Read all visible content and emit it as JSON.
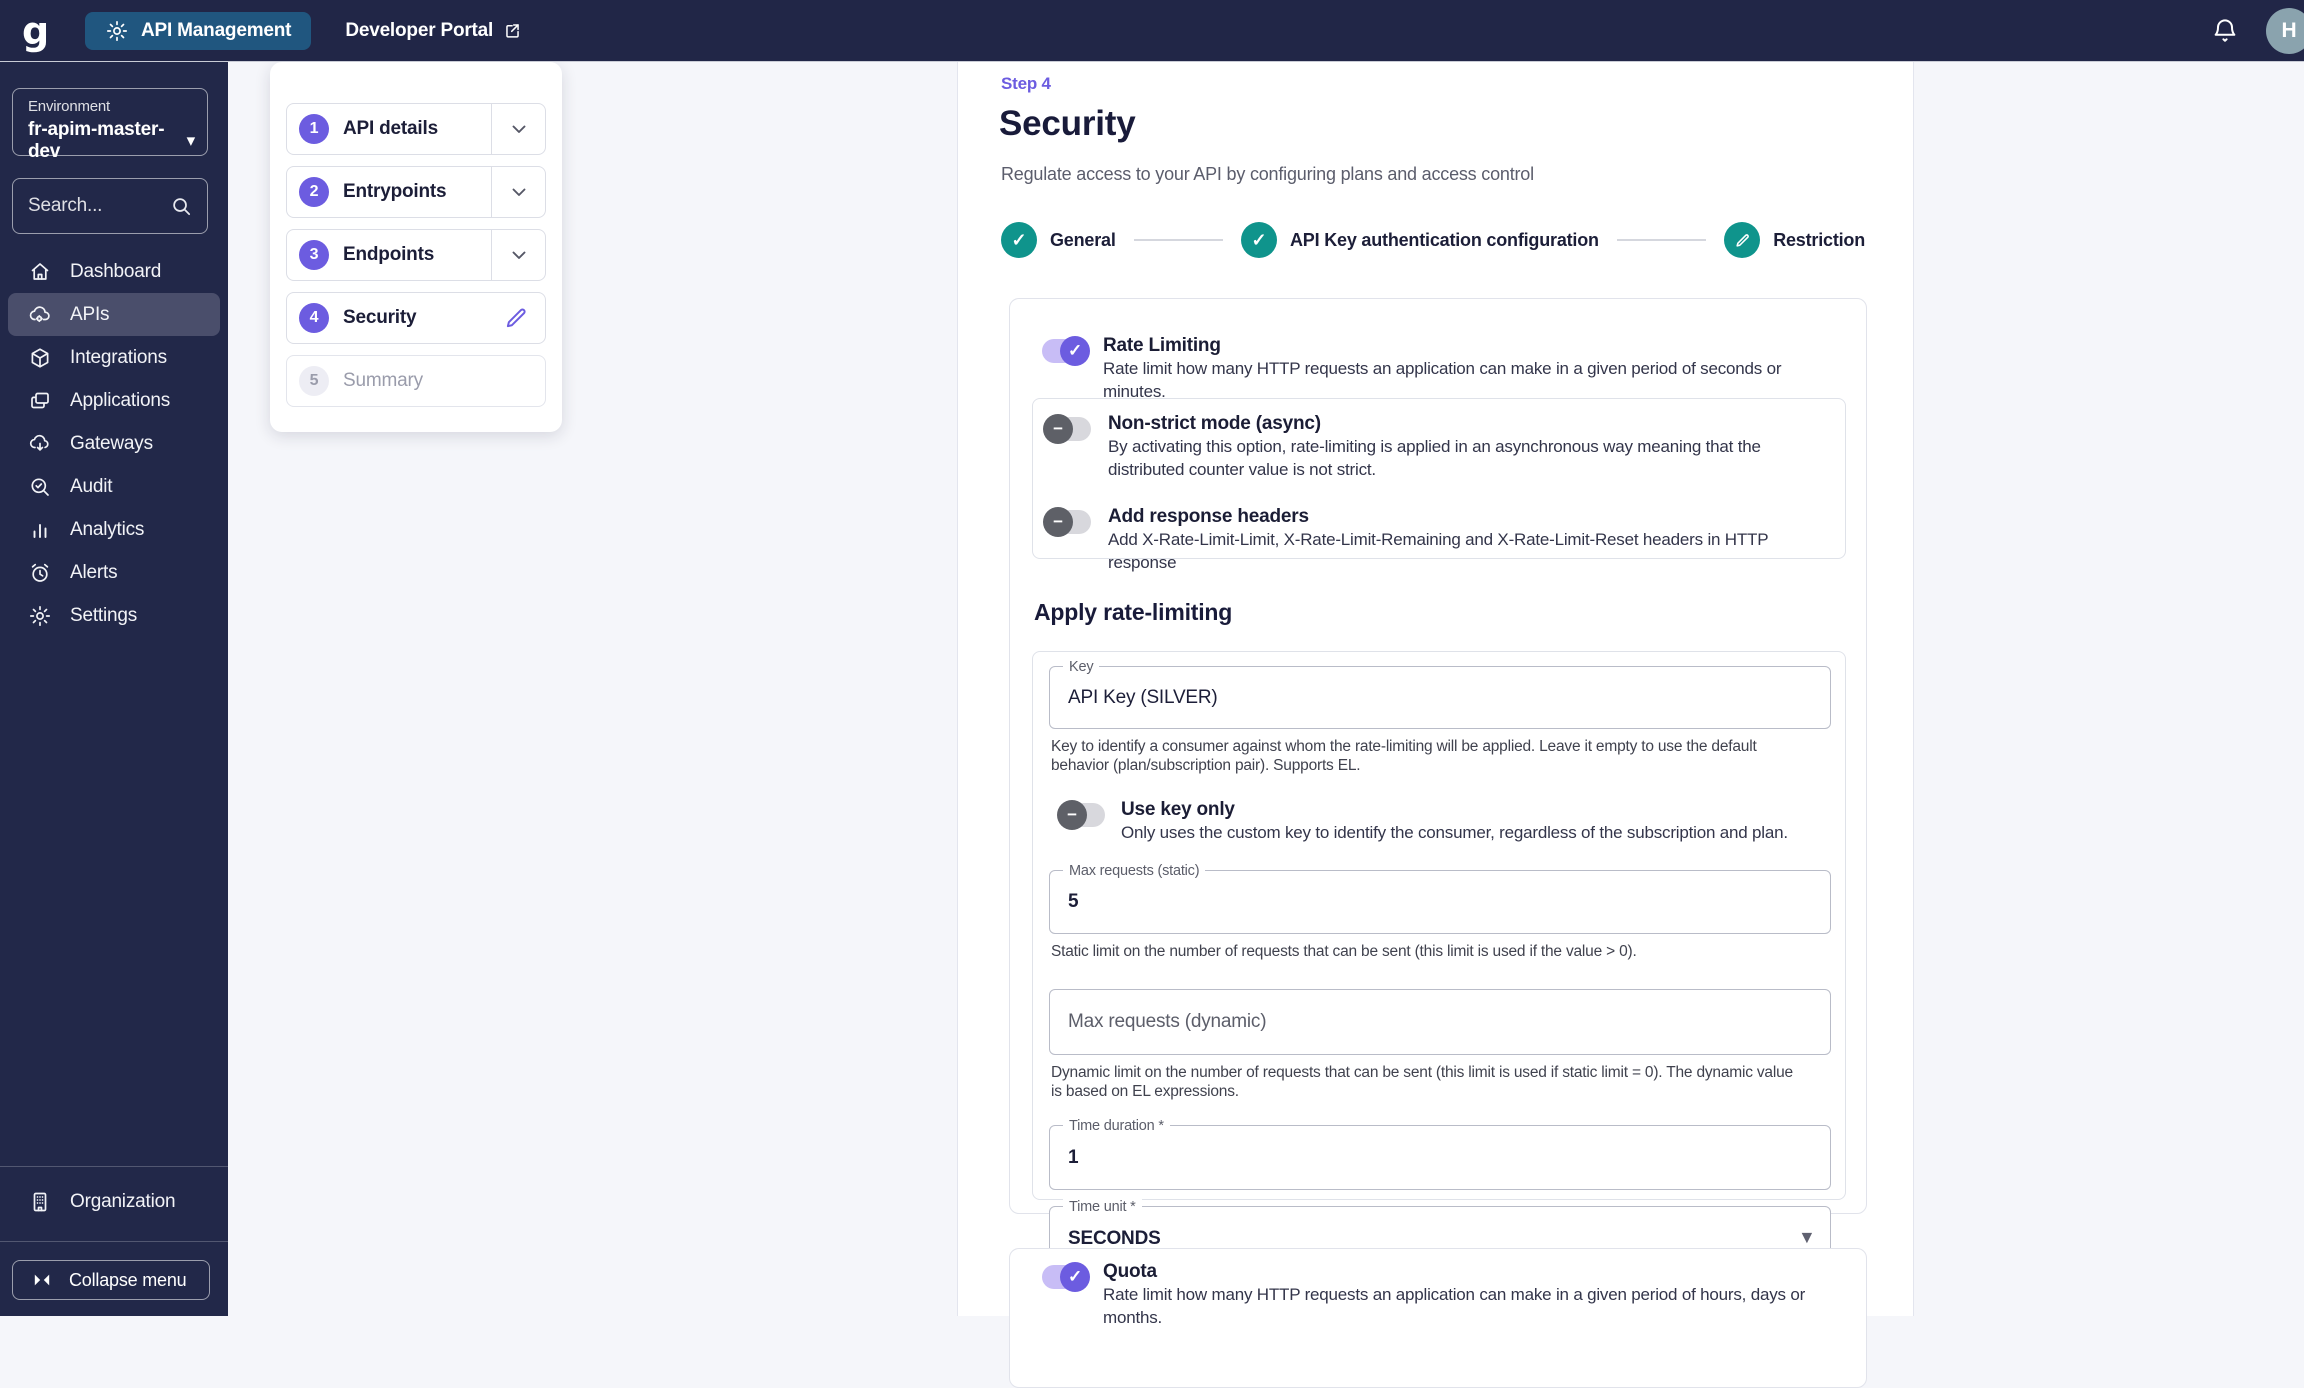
{
  "topbar": {
    "logo": "g",
    "apim_label": "API Management",
    "portal_label": "Developer Portal",
    "avatar_initial": "H"
  },
  "sidebar": {
    "environment_label": "Environment",
    "environment_value": "fr-apim-master-dev",
    "search_placeholder": "Search...",
    "items": [
      {
        "label": "Dashboard",
        "icon": "home-icon",
        "selected": false
      },
      {
        "label": "APIs",
        "icon": "cloud-gear-icon",
        "selected": true
      },
      {
        "label": "Integrations",
        "icon": "cube-icon",
        "selected": false
      },
      {
        "label": "Applications",
        "icon": "copies-icon",
        "selected": false
      },
      {
        "label": "Gateways",
        "icon": "cloud-down-icon",
        "selected": false
      },
      {
        "label": "Audit",
        "icon": "search-check-icon",
        "selected": false
      },
      {
        "label": "Analytics",
        "icon": "bar-chart-icon",
        "selected": false
      },
      {
        "label": "Alerts",
        "icon": "alarm-icon",
        "selected": false
      },
      {
        "label": "Settings",
        "icon": "gear-icon",
        "selected": false
      }
    ],
    "organization_label": "Organization",
    "collapse_label": "Collapse menu"
  },
  "wizard": {
    "steps": [
      {
        "number": "1",
        "label": "API details",
        "state": "done"
      },
      {
        "number": "2",
        "label": "Entrypoints",
        "state": "done"
      },
      {
        "number": "3",
        "label": "Endpoints",
        "state": "done"
      },
      {
        "number": "4",
        "label": "Security",
        "state": "active"
      },
      {
        "number": "5",
        "label": "Summary",
        "state": "disabled"
      }
    ]
  },
  "main": {
    "step_label": "Step 4",
    "title": "Security",
    "subtitle": "Regulate access to your API by configuring plans and access control",
    "progress": [
      {
        "label": "General",
        "icon": "check-icon"
      },
      {
        "label": "API Key authentication configuration",
        "icon": "check-icon"
      },
      {
        "label": "Restriction",
        "icon": "pencil-icon"
      }
    ],
    "rate_limiting": {
      "title": "Rate Limiting",
      "description": "Rate limit how many HTTP requests an application can make in a given period of seconds or minutes.",
      "enabled": true,
      "options": [
        {
          "title": "Non-strict mode (async)",
          "description": "By activating this option, rate-limiting is applied in an asynchronous way meaning that the distributed counter value is not strict.",
          "enabled": false
        },
        {
          "title": "Add response headers",
          "description": "Add X-Rate-Limit-Limit, X-Rate-Limit-Remaining and X-Rate-Limit-Reset headers in HTTP response",
          "enabled": false
        }
      ],
      "apply_heading": "Apply rate-limiting",
      "key_field": {
        "label": "Key",
        "value": "API Key (SILVER)",
        "helper": "Key to identify a consumer against whom the rate-limiting will be applied. Leave it empty to use the default behavior (plan/subscription pair). Supports EL."
      },
      "use_key_only": {
        "title": "Use key only",
        "description": "Only uses the custom key to identify the consumer, regardless of the subscription and plan.",
        "enabled": false
      },
      "max_static": {
        "label": "Max requests (static)",
        "value": "5",
        "helper": "Static limit on the number of requests that can be sent (this limit is used if the value > 0)."
      },
      "max_dynamic": {
        "label": "Max requests (dynamic)",
        "value": "",
        "helper": "Dynamic limit on the number of requests that can be sent (this limit is used if static limit = 0). The dynamic value is based on EL expressions."
      },
      "time_duration": {
        "label": "Time duration *",
        "value": "1"
      },
      "time_unit": {
        "label": "Time unit *",
        "value": "SECONDS"
      }
    },
    "quota": {
      "title": "Quota",
      "description": "Rate limit how many HTTP requests an application can make in a given period of hours, days or months.",
      "enabled": true
    }
  },
  "icons": {
    "check": "✓",
    "minus": "−",
    "caret_down": "▾"
  },
  "colors": {
    "topbar_bg": "#212647",
    "sidebar_bg": "#222849",
    "accent_purple": "#6c5ce0",
    "accent_purple_track": "#c8bdf6",
    "teal": "#0f948c",
    "apim_button_blue": "#20567f",
    "page_bg": "#f5f6fa"
  }
}
